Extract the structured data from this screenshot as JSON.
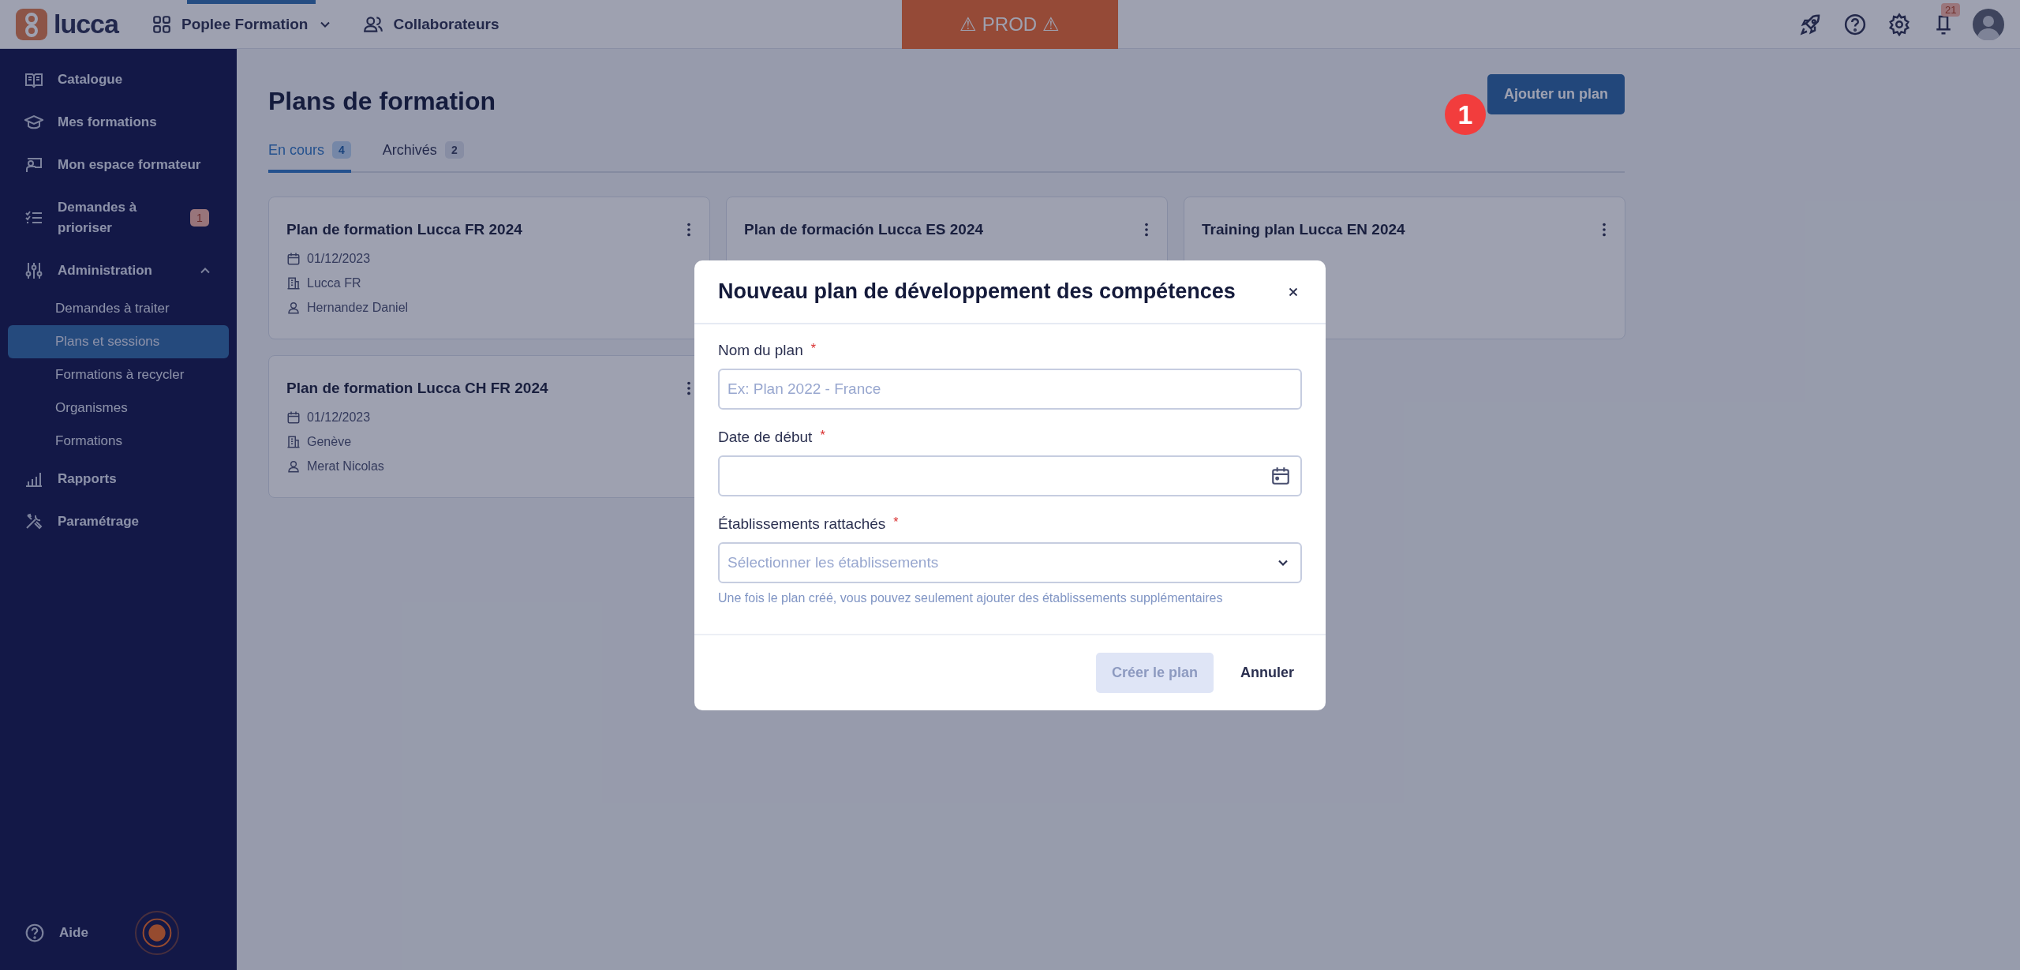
{
  "topbar": {
    "logo": "lucca",
    "app_menu": "Poplee Formation",
    "nav_link": "Collaborateurs",
    "env_banner": "⚠ PROD ⚠",
    "notification_count": "21"
  },
  "sidebar": {
    "items": [
      {
        "label": "Catalogue",
        "selected": false
      },
      {
        "label": "Mes formations",
        "selected": false
      },
      {
        "label": "Mon espace formateur",
        "selected": false
      },
      {
        "label": "Demandes à prioriser",
        "badge": "1",
        "selected": false
      },
      {
        "label": "Administration",
        "expanded": true,
        "selected": false,
        "children": [
          {
            "label": "Demandes à traiter",
            "selected": false
          },
          {
            "label": "Plans et sessions",
            "selected": true
          },
          {
            "label": "Formations à recycler",
            "selected": false
          },
          {
            "label": "Organismes",
            "selected": false
          },
          {
            "label": "Formations",
            "selected": false
          }
        ]
      },
      {
        "label": "Rapports",
        "selected": false
      },
      {
        "label": "Paramétrage",
        "selected": false
      }
    ],
    "help": "Aide"
  },
  "page": {
    "title": "Plans de formation",
    "add_button": "Ajouter un plan",
    "step_marker": "1",
    "tabs": [
      {
        "label": "En cours",
        "count": "4",
        "selected": true
      },
      {
        "label": "Archivés",
        "count": "2",
        "selected": false
      }
    ],
    "cards": [
      {
        "title": "Plan de formation Lucca FR 2024",
        "date": "01/12/2023",
        "establishment": "Lucca FR",
        "owner": "Hernandez Daniel"
      },
      {
        "title": "Plan de formación Lucca ES 2024"
      },
      {
        "title": "Training plan Lucca EN 2024"
      },
      {
        "title": "Plan de formation Lucca CH FR 2024",
        "date": "01/12/2023",
        "establishment": "Genève",
        "owner": "Merat Nicolas"
      }
    ]
  },
  "modal": {
    "title": "Nouveau plan de développement des compétences",
    "required_mark": "*",
    "fields": [
      {
        "kind": "text",
        "label": "Nom du plan",
        "required": true,
        "placeholder": "Ex: Plan 2022 - France"
      },
      {
        "kind": "date",
        "label": "Date de début",
        "required": true
      },
      {
        "kind": "select",
        "label": "Établissements rattachés",
        "required": true,
        "placeholder": "Sélectionner les établissements",
        "hint": "Une fois le plan créé, vous pouvez seulement ajouter des établissements supplémentaires"
      }
    ],
    "submit": {
      "label": "Créer le plan",
      "disabled": true
    },
    "cancel": "Annuler"
  }
}
